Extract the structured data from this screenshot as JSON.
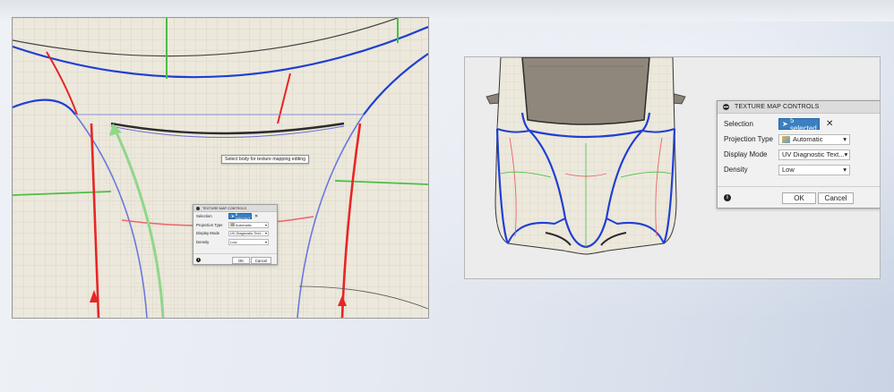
{
  "tooltip": "Select body for texture mapping editing",
  "dialogs": {
    "large": {
      "title": "TEXTURE MAP CONTROLS",
      "selection_label": "Selection",
      "selection_value": "5 selected",
      "projection_label": "Projection Type",
      "projection_value": "Automatic",
      "display_label": "Display Mode",
      "display_value": "UV Diagnostic Text...",
      "density_label": "Density",
      "density_value": "Low",
      "ok_label": "OK",
      "cancel_label": "Cancel",
      "info_glyph": "i",
      "close_glyph": "✕",
      "caret_glyph": "▾"
    },
    "small": {
      "title": "TEXTURE MAP CONTROLS",
      "selection_label": "Selection",
      "selection_value": "5 selected",
      "projection_label": "Projection Type",
      "projection_value": "Automatic",
      "display_label": "Display Mode",
      "display_value": "UV Diagnostic Text...",
      "density_label": "Density",
      "density_value": "Low",
      "ok_label": "OK",
      "cancel_label": "Cancel",
      "info_glyph": "i",
      "close_glyph": "✕",
      "caret_glyph": "▾"
    }
  },
  "colors": {
    "selection_blue": "#3a7fc2",
    "edge_blue": "#1f3fd4",
    "seam_red": "#e82525",
    "guide_green": "#4bbf45",
    "surface": "#ece8dc"
  },
  "icons": [
    "cursor-arrow-icon",
    "automatic-projection-icon",
    "info-icon",
    "close-icon",
    "chevron-down-icon",
    "collapse-icon"
  ]
}
